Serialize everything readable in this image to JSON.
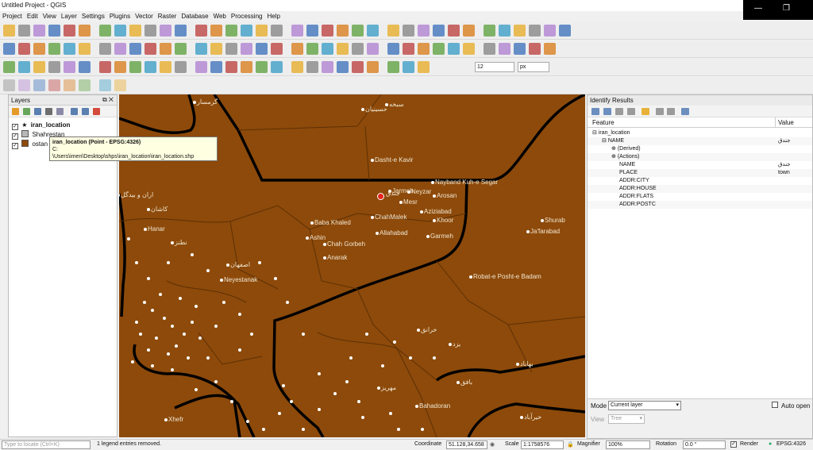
{
  "window": {
    "title": "Untitled Project - QGIS",
    "minimize": "—",
    "restore": "❐"
  },
  "menu": [
    "Project",
    "Edit",
    "View",
    "Layer",
    "Settings",
    "Plugins",
    "Vector",
    "Raster",
    "Database",
    "Web",
    "Processing",
    "Help"
  ],
  "toolbar": {
    "field_size": "12",
    "field_unit": "px"
  },
  "layers": {
    "title": "Layers",
    "items": [
      {
        "name": "iran_location",
        "checked": true,
        "symbol": "star",
        "bold": true
      },
      {
        "name": "Shahrestan",
        "checked": true,
        "symbol": "gray"
      },
      {
        "name": "ostan",
        "checked": true,
        "symbol": "brown"
      }
    ],
    "tooltip_line1": "iran_location (Point - EPSG:4326)",
    "tooltip_line2": "C:",
    "tooltip_line3": "\\Users\\imen\\Desktop\\shps\\iran_location\\iran_location.shp"
  },
  "map": {
    "labels": [
      "گرمسار",
      "سبخه",
      "حسینیان",
      "Dasht-e Kavir",
      "Nayband Kuh-e Segar",
      "اران و بیدگل",
      "کاشان",
      "Baba Khaled",
      "ChahMalek",
      "Mesr",
      "Neyzar",
      "Jarmeh",
      "Arosan",
      "Aziziabad",
      "Khoor",
      "Garmeh",
      "Allahabad",
      "Ashin",
      "Chah Gorbeh",
      "Anarak",
      "Hanar",
      "نطنز",
      "Neyestanak",
      "اصفهان",
      "Robat-e Posht-e Badam",
      "Shurab",
      "Ja'farabad",
      "خرانق",
      "بهاباد",
      "یزد",
      "مهریز",
      "Bahadoran",
      "Xhefr",
      "بافق",
      "خیرآباد"
    ],
    "selected_point_label": "جندق"
  },
  "identify": {
    "title": "Identify Results",
    "col_feature": "Feature",
    "col_value": "Value",
    "rows": [
      {
        "indent": 0,
        "prefix": "⊟",
        "label": "iran_location",
        "value": ""
      },
      {
        "indent": 1,
        "prefix": "⊟",
        "label": "NAME",
        "value": "جندق"
      },
      {
        "indent": 2,
        "prefix": "⊕",
        "label": "(Derived)",
        "value": ""
      },
      {
        "indent": 2,
        "prefix": "⊕",
        "label": "(Actions)",
        "value": ""
      },
      {
        "indent": 2,
        "prefix": "",
        "label": "NAME",
        "value": "جندق"
      },
      {
        "indent": 2,
        "prefix": "",
        "label": "PLACE",
        "value": "town"
      },
      {
        "indent": 2,
        "prefix": "",
        "label": "ADDR:CITY",
        "value": ""
      },
      {
        "indent": 2,
        "prefix": "",
        "label": "ADDR:HOUSE",
        "value": ""
      },
      {
        "indent": 2,
        "prefix": "",
        "label": "ADDR:FLATS",
        "value": ""
      },
      {
        "indent": 2,
        "prefix": "",
        "label": "ADDR:POSTC",
        "value": ""
      }
    ],
    "mode_label": "Mode",
    "mode_value": "Current layer",
    "auto_open": "Auto open",
    "view_label": "View",
    "view_value": "Tree"
  },
  "status": {
    "locate_placeholder": "Type to locate (Ctrl+K)",
    "message": "1 legend entries removed.",
    "coordinate_label": "Coordinate",
    "coordinate": "51.128,34.658",
    "scale_label": "Scale",
    "scale": "1:1758576",
    "magnifier_label": "Magnifier",
    "magnifier": "100%",
    "rotation_label": "Rotation",
    "rotation": "0.0 °",
    "render_label": "Render",
    "crs": "EPSG:4326"
  }
}
